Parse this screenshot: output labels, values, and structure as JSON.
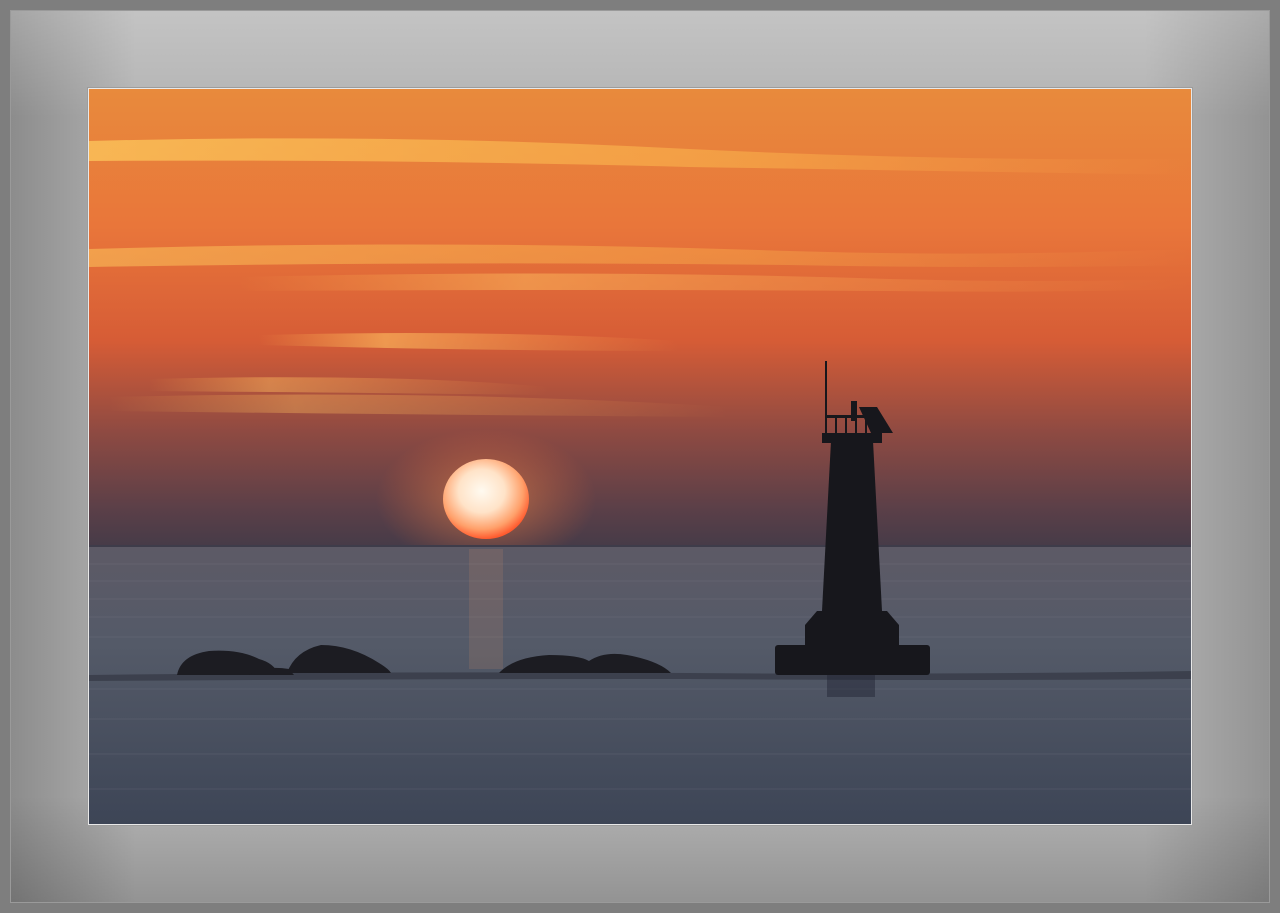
{
  "scene": {
    "description_icons": [
      "sun-icon",
      "lighthouse-icon",
      "rock-icon"
    ],
    "colors": {
      "sky_top": "#e9893a",
      "sky_mid": "#e2672f",
      "sky_low": "#7a4a47",
      "horizon": "#4a3a45",
      "sea": "#4e5463",
      "sea_dark": "#2c3240",
      "sun_core": "#fff6e6",
      "sun_edge": "#ff5a2a",
      "silhouette": "#1a1a1f",
      "mat": "#b3b3b3",
      "outer": "#7e7e7e"
    }
  }
}
